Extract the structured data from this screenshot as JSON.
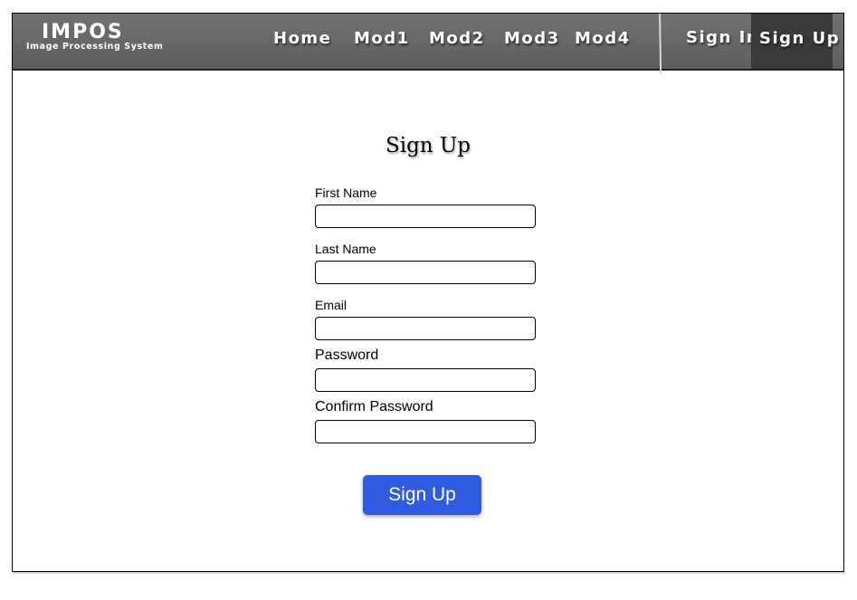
{
  "brand": {
    "title": "IMPOS",
    "subtitle": "Image Processing System"
  },
  "nav": {
    "links": [
      {
        "label": "Home"
      },
      {
        "label": "Mod1"
      },
      {
        "label": "Mod2"
      },
      {
        "label": "Mod3"
      },
      {
        "label": "Mod4"
      }
    ],
    "sign_in": "Sign In",
    "sign_up": "Sign Up",
    "active": "Sign Up"
  },
  "form": {
    "title": "Sign Up",
    "fields": [
      {
        "label": "First Name",
        "value": "",
        "placeholder": ""
      },
      {
        "label": "Last Name",
        "value": "",
        "placeholder": ""
      },
      {
        "label": "Email",
        "value": "",
        "placeholder": ""
      },
      {
        "label": "Password",
        "value": "",
        "placeholder": ""
      },
      {
        "label": "Confirm Password",
        "value": "",
        "placeholder": ""
      }
    ],
    "submit_label": "Sign Up"
  },
  "colors": {
    "navbar": "#666666",
    "active_nav": "#3a3a3a",
    "button": "#2f5be0",
    "text_light": "#ffffff"
  }
}
